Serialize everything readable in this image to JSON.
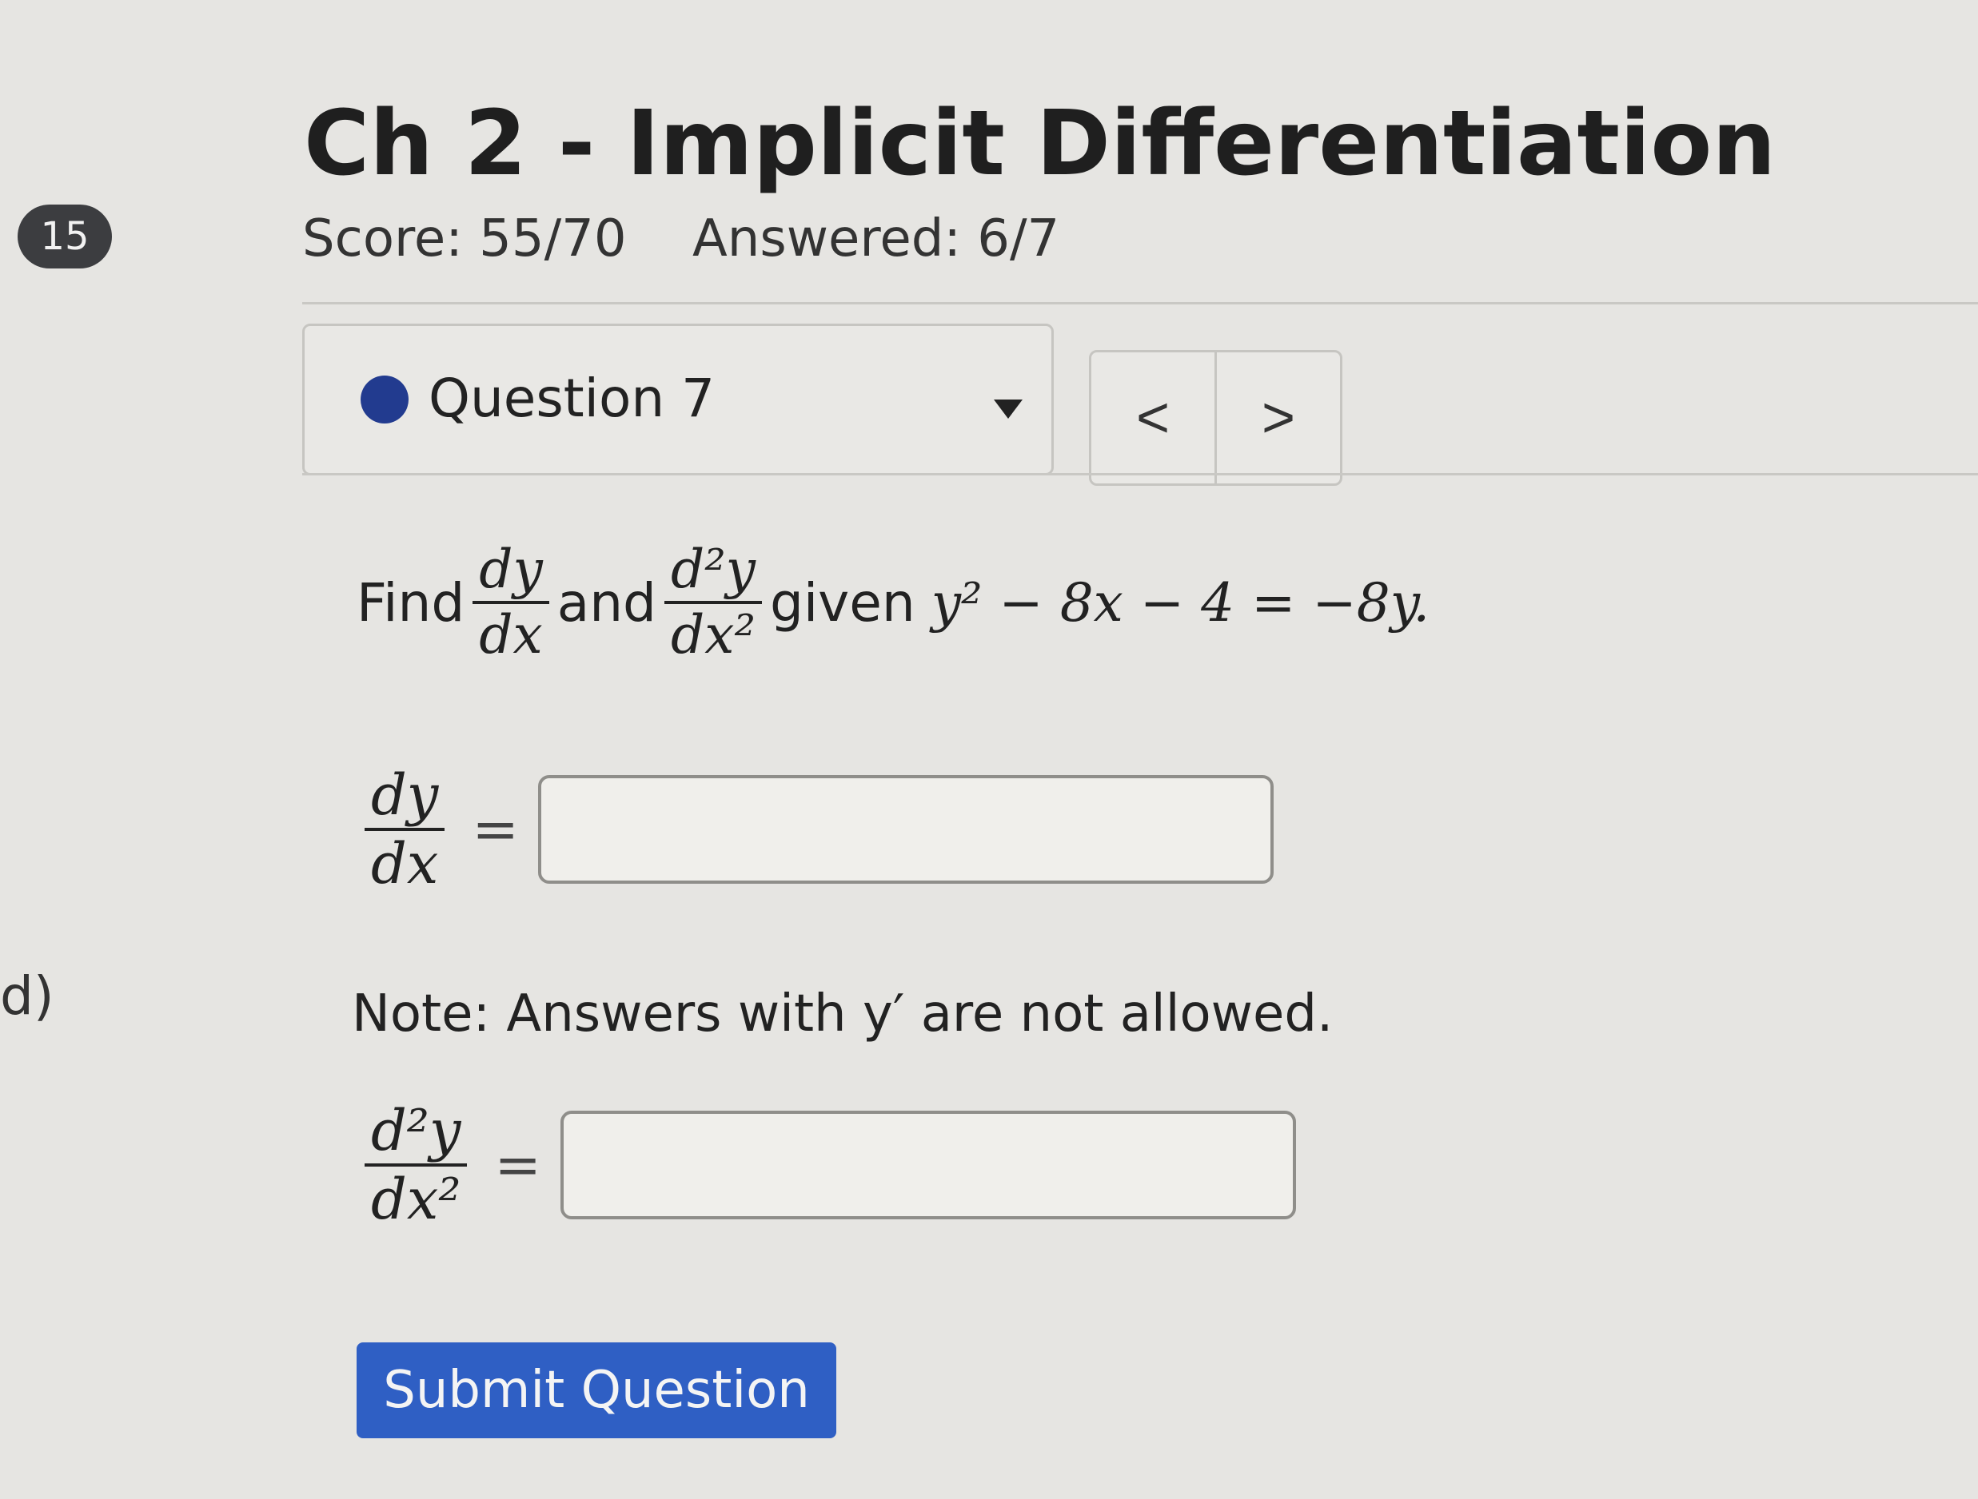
{
  "page_number": "15",
  "side_label": "d)",
  "assignment": {
    "title": "Ch 2 - Implicit Differentiation",
    "score": "Score: 55/70",
    "answered": "Answered: 6/7"
  },
  "question_selector": {
    "label": "Question 7",
    "prev_glyph": "<",
    "next_glyph": ">"
  },
  "problem": {
    "find": "Find",
    "and": "and",
    "given": "given",
    "equation": "y² − 8x − 4 = −8y.",
    "first_derivative": {
      "num": "dy",
      "den": "dx"
    },
    "second_derivative": {
      "num": "d²y",
      "den": "dx²"
    },
    "equals": "="
  },
  "answers": {
    "dy_dx_value": "",
    "d2y_dx2_value": ""
  },
  "note": "Note: Answers with y′ are not allowed.",
  "submit_label": "Submit Question",
  "colors": {
    "accent": "#2f5fc4",
    "dot": "#223b8f",
    "badge": "#3c3d40"
  }
}
